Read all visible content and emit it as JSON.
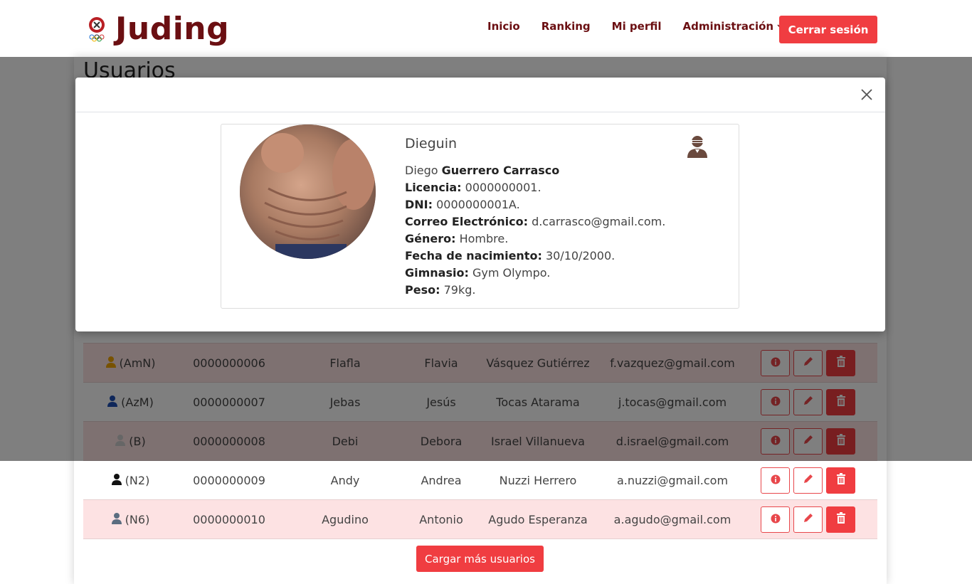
{
  "brand": {
    "name": "Juding"
  },
  "nav": {
    "links": [
      "Inicio",
      "Ranking",
      "Mi perfil"
    ],
    "admin_label": "Administración",
    "logout_label": "Cerrar sesión"
  },
  "page": {
    "title": "Usuarios",
    "load_more_label": "Cargar más usuarios"
  },
  "table": {
    "rows": [
      {
        "level": "(AmN)",
        "level_color": "#f0a500",
        "licence": "0000000006",
        "username": "Flafla",
        "name": "Flavia",
        "surname": "Vásquez Gutiérrez",
        "email": "f.vazquez@gmail.com",
        "pink": true
      },
      {
        "level": "(AzM)",
        "level_color": "#1e4fb5",
        "licence": "0000000007",
        "username": "Jebas",
        "name": "Jesús",
        "surname": "Tocas Atarama",
        "email": "j.tocas@gmail.com",
        "pink": false
      },
      {
        "level": "(B)",
        "level_color": "#cccccc",
        "licence": "0000000008",
        "username": "Debi",
        "name": "Debora",
        "surname": "Israel Villanueva",
        "email": "d.israel@gmail.com",
        "pink": true
      },
      {
        "level": "(N2)",
        "level_color": "#111111",
        "licence": "0000000009",
        "username": "Andy",
        "name": "Andrea",
        "surname": "Nuzzi Herrero",
        "email": "a.nuzzi@gmail.com",
        "pink": false
      },
      {
        "level": "(N6)",
        "level_color": "#5b6d80",
        "licence": "0000000010",
        "username": "Agudino",
        "name": "Antonio",
        "surname": "Agudo Esperanza",
        "email": "a.agudo@gmail.com",
        "pink": true
      }
    ]
  },
  "modal": {
    "close_icon": "close-icon",
    "nickname": "Dieguin",
    "first_name": "Diego",
    "last_name": "Guerrero Carrasco",
    "fields": [
      {
        "label": "Licencia:",
        "value": "0000000001."
      },
      {
        "label": "DNI:",
        "value": "0000000001A."
      },
      {
        "label": "Correo Electrónico:",
        "value": "d.carrasco@gmail.com."
      },
      {
        "label": "Género:",
        "value": "Hombre."
      },
      {
        "label": "Fecha de nacimiento:",
        "value": "30/10/2000."
      },
      {
        "label": "Gimnasio:",
        "value": "Gym Olympo."
      },
      {
        "label": "Peso:",
        "value": "79kg."
      }
    ],
    "role_icon": "ninja-user-icon"
  },
  "colors": {
    "accent": "#f03d41",
    "brand": "#6b0f12",
    "row_pink": "#fde2e3"
  }
}
